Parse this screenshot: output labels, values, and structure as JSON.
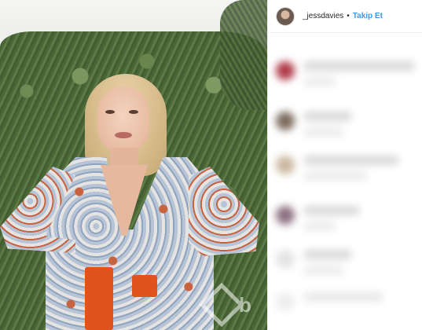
{
  "post": {
    "username": "_jessdavies",
    "separator": "•",
    "follow_label": "Takip Et"
  },
  "watermark": {
    "text": "b"
  },
  "colors": {
    "follow_blue": "#3897f0",
    "belt_orange": "#e0531e"
  },
  "icons": {
    "avatar": "profile-photo",
    "watermark": "site-logo"
  }
}
